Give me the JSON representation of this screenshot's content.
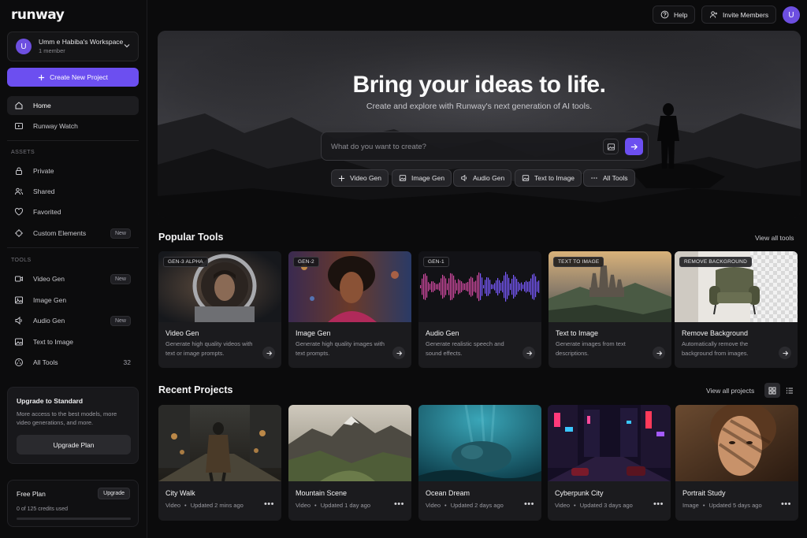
{
  "brand": {
    "logo": "runway",
    "accent": "#6c4ff0"
  },
  "workspace": {
    "initial": "U",
    "name": "Umm e Habiba's Workspace",
    "members": "1 member"
  },
  "sidebar": {
    "create_label": "Create New Project",
    "nav": [
      {
        "label": "Home",
        "icon": "home-icon",
        "active": true
      },
      {
        "label": "Runway Watch",
        "icon": "tv-icon"
      }
    ],
    "assets_heading": "ASSETS",
    "assets": [
      {
        "label": "Private",
        "icon": "lock-icon"
      },
      {
        "label": "Shared",
        "icon": "users-icon"
      },
      {
        "label": "Favorited",
        "icon": "heart-icon"
      },
      {
        "label": "Custom Elements",
        "icon": "elements-icon",
        "badge": "New"
      }
    ],
    "tools_heading": "TOOLS",
    "tools": [
      {
        "label": "Video Gen",
        "icon": "video-icon",
        "badge": "New"
      },
      {
        "label": "Image Gen",
        "icon": "image-icon"
      },
      {
        "label": "Audio Gen",
        "icon": "audio-icon",
        "badge": "New"
      },
      {
        "label": "Text to Image",
        "icon": "text-image-icon"
      },
      {
        "label": "All Tools",
        "icon": "grid-icon",
        "count": "32"
      }
    ],
    "upgrade": {
      "title": "Upgrade to Standard",
      "desc": "More access to the best models, more video generations, and more.",
      "button": "Upgrade Plan"
    },
    "plan": {
      "title": "Free Plan",
      "button": "Upgrade",
      "credits": "0 of 125 credits used",
      "progress": 0.0
    }
  },
  "topbar": {
    "help": "Help",
    "invite": "Invite Members",
    "avatar": "U"
  },
  "hero": {
    "title": "Bring your ideas to life.",
    "subtitle": "Create and explore with Runway's next generation of AI tools.",
    "placeholder": "What do you want to create?",
    "chips": [
      {
        "label": "Video Gen",
        "icon": "plus-icon"
      },
      {
        "label": "Image Gen",
        "icon": "image-icon"
      },
      {
        "label": "Audio Gen",
        "icon": "audio-icon"
      },
      {
        "label": "Text to Image",
        "icon": "text-image-icon"
      },
      {
        "label": "All Tools",
        "icon": "ellipsis-icon"
      }
    ]
  },
  "popular": {
    "title": "Popular Tools",
    "view_all": "View all tools",
    "cards": [
      {
        "tag": "GEN-3 ALPHA",
        "name": "Video Gen",
        "desc": "Generate high quality videos with text or image prompts."
      },
      {
        "tag": "GEN-2",
        "name": "Image Gen",
        "desc": "Generate high quality images with text prompts."
      },
      {
        "tag": "GEN-1",
        "name": "Audio Gen",
        "desc": "Generate realistic speech and sound effects."
      },
      {
        "tag": "TEXT TO IMAGE",
        "name": "Text to Image",
        "desc": "Generate images from text descriptions."
      },
      {
        "tag": "REMOVE BACKGROUND",
        "name": "Remove Background",
        "desc": "Automatically remove the background from images."
      }
    ]
  },
  "recent": {
    "title": "Recent Projects",
    "view_all": "View all projects",
    "projects": [
      {
        "name": "City Walk",
        "type": "Video",
        "updated": "Updated 2 mins ago"
      },
      {
        "name": "Mountain Scene",
        "type": "Video",
        "updated": "Updated 1 day ago"
      },
      {
        "name": "Ocean Dream",
        "type": "Video",
        "updated": "Updated 2 days ago"
      },
      {
        "name": "Cyberpunk City",
        "type": "Video",
        "updated": "Updated 3 days ago"
      },
      {
        "name": "Portrait Study",
        "type": "Image",
        "updated": "Updated 5 days ago"
      }
    ],
    "dot": "•",
    "more": "•••"
  }
}
